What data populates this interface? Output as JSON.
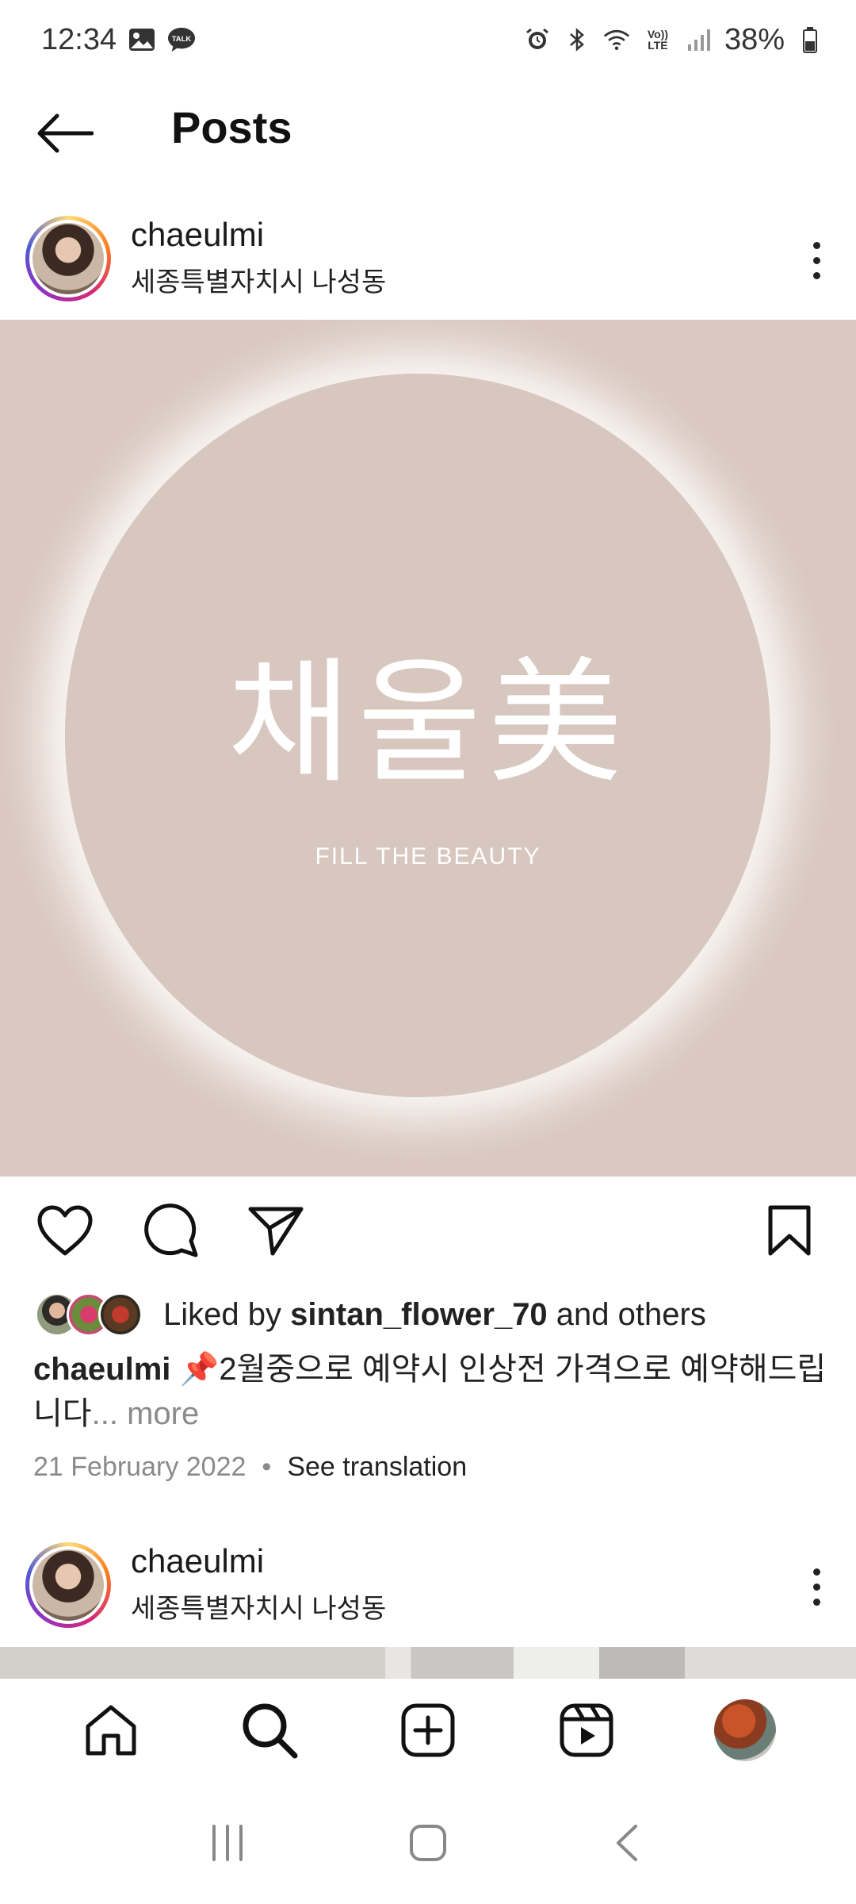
{
  "status_bar": {
    "time": "12:34",
    "battery": "38%",
    "icons": [
      "gallery-icon",
      "talk-icon",
      "alarm-icon",
      "bluetooth-icon",
      "wifi-icon",
      "volte-icon",
      "signal-icon",
      "battery-icon"
    ],
    "talk_badge": "TALK",
    "volte": "Vo)) LTE"
  },
  "top_bar": {
    "title": "Posts"
  },
  "post": {
    "username": "chaeulmi",
    "location": "세종특별자치시 나성동",
    "image_logo": "채울美",
    "image_subtext": "FILL THE  BEAUTY",
    "likes_prefix": "Liked by ",
    "likes_user": "sintan_flower_70",
    "likes_suffix": " and others",
    "caption_user": "chaeulmi",
    "caption_text": " 📌2월중으로 예약시 인상전 가격으로 예약해드립니다",
    "caption_more": "... more",
    "date": "21 February 2022",
    "separator": "•",
    "see_translation": "See translation"
  },
  "next_post": {
    "username": "chaeulmi",
    "location": "세종특별자치시 나성동"
  },
  "colors": {
    "post_bg": "#d9c8c0",
    "text": "#111111",
    "muted": "#8a8a8a"
  }
}
